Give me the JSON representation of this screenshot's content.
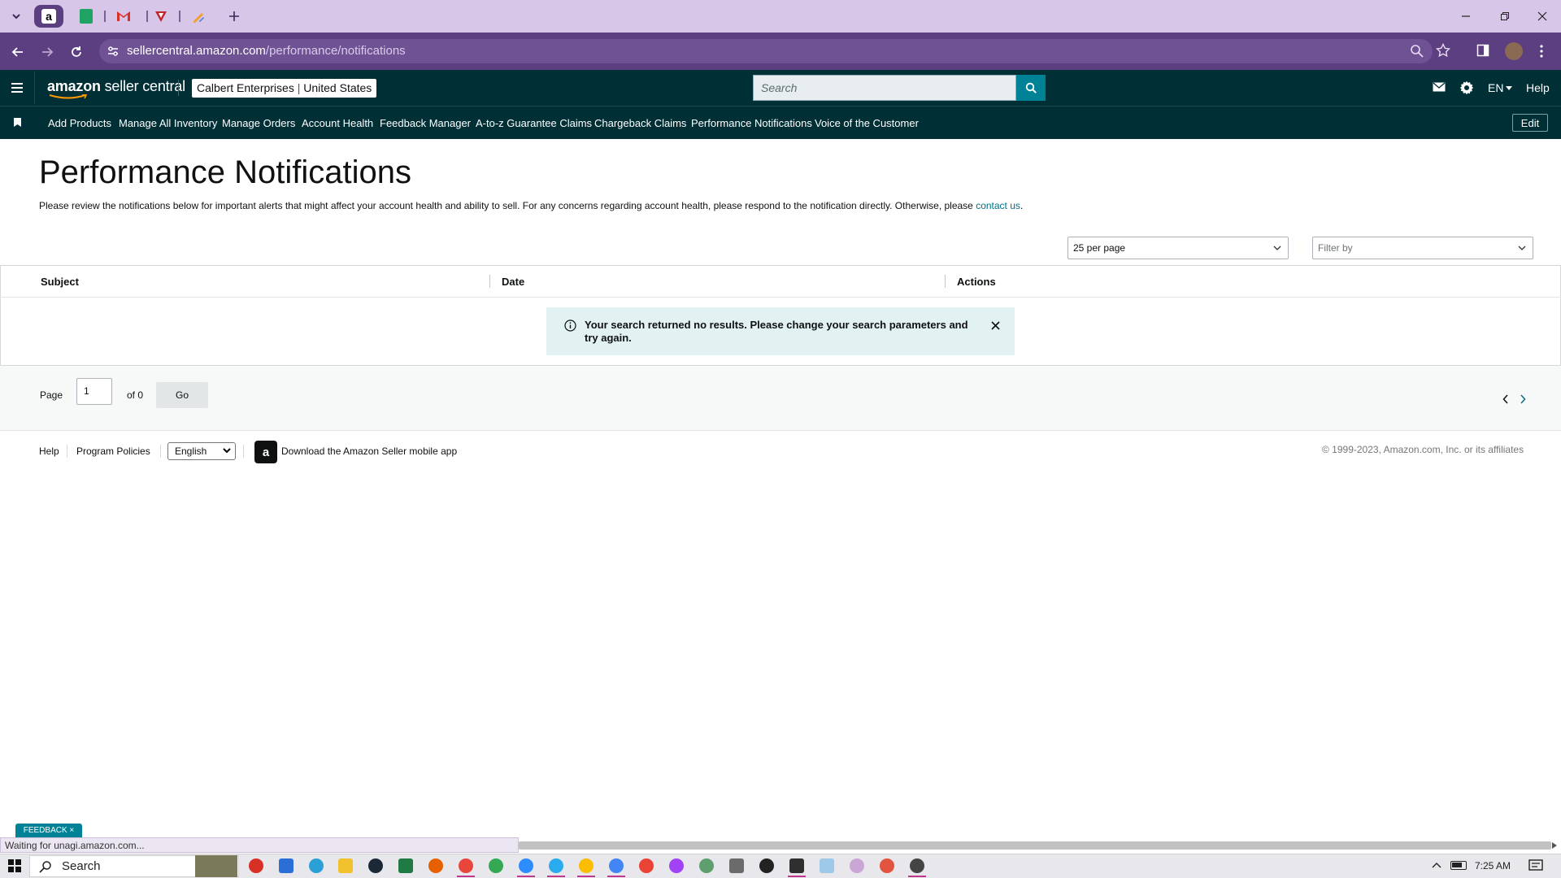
{
  "browser": {
    "url_host": "sellercentral.amazon.com",
    "url_path": "/performance/notifications",
    "status_text": "Waiting for unagi.amazon.com..."
  },
  "header": {
    "logo_bold": "amazon",
    "logo_rest": " seller central",
    "account_name": "Calbert Enterprises",
    "account_region": "United States",
    "search_placeholder": "Search",
    "language": "EN",
    "help": "Help"
  },
  "nav": {
    "items": [
      "Add Products",
      "Manage All Inventory",
      "Manage Orders",
      "Account Health",
      "Feedback Manager",
      "A-to-z Guarantee Claims",
      "Chargeback Claims",
      "Performance Notifications",
      "Voice of the Customer"
    ],
    "edit": "Edit"
  },
  "page": {
    "title": "Performance Notifications",
    "description": "Please review the notifications below for important alerts that might affect your account health and ability to sell. For any concerns regarding account health, please respond to the notification directly. Otherwise, please ",
    "contact_link": "contact us",
    "description_end": ".",
    "per_page": "25 per page",
    "filter_by": "Filter by"
  },
  "table": {
    "columns": [
      "Subject",
      "Date",
      "Actions"
    ],
    "empty_message": "Your search returned no results. Please change your search parameters and try again."
  },
  "pager": {
    "page_label": "Page",
    "page_value": "1",
    "of_label": "of 0",
    "go": "Go"
  },
  "footer": {
    "help": "Help",
    "program_policies": "Program Policies",
    "language": "English",
    "app_icon_letter": "a",
    "download": "Download the Amazon Seller mobile app",
    "copyright": "© 1999-2023, Amazon.com, Inc. or its affiliates"
  },
  "feedback": "FEEDBACK ×",
  "taskbar": {
    "search": "Search",
    "time": "7:25 AM"
  },
  "colors": {
    "header_bg": "#002f36",
    "accent_teal": "#008296",
    "browser_purple": "#5c3f81",
    "tabbar_lilac": "#d8c6e9"
  }
}
